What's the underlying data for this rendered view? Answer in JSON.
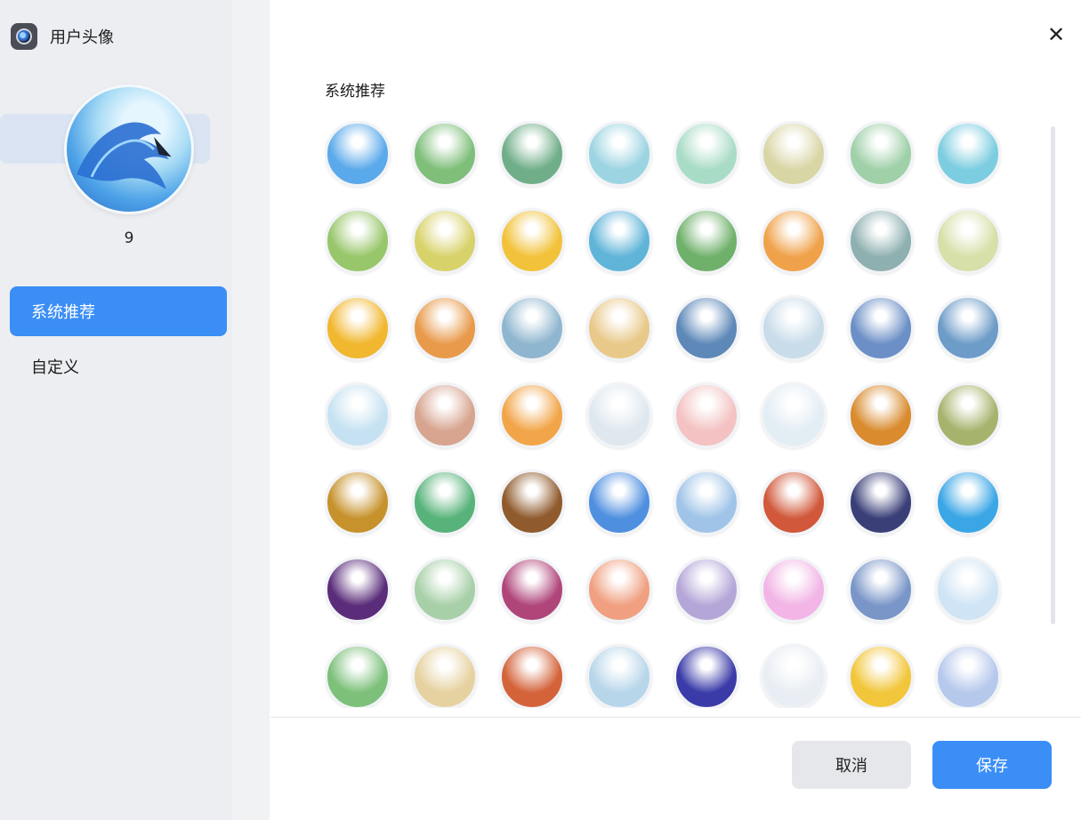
{
  "window": {
    "title": "用户头像"
  },
  "sidebar": {
    "current_avatar_number": "9",
    "items": [
      {
        "label": "系统推荐",
        "active": true
      },
      {
        "label": "自定义",
        "active": false
      }
    ]
  },
  "main": {
    "section_title": "系统推荐",
    "avatars": [
      "#5aa9ea",
      "#7fbf7a",
      "#6fae88",
      "#9cd4e2",
      "#a9dcc6",
      "#d9d6a6",
      "#9fd0a8",
      "#7ccde0",
      "#98c66a",
      "#d8d26a",
      "#f2c23a",
      "#5fb4d8",
      "#6fb06a",
      "#f0a24a",
      "#8fb0b0",
      "#d6e0a8",
      "#f1b72e",
      "#e89a4a",
      "#8fb6cf",
      "#e9c98a",
      "#5d88b8",
      "#c9dcea",
      "#6b8fc6",
      "#6d9cc8",
      "#c6e2f2",
      "#d7a48f",
      "#f2a548",
      "#dfe8ef",
      "#f4c2c2",
      "#e3edf4",
      "#d98b2e",
      "#a6b36c",
      "#c7922c",
      "#58b37a",
      "#8f5a2c",
      "#4f8fe0",
      "#9fc4e8",
      "#d1583a",
      "#3a3f78",
      "#3aa6e6",
      "#5a2c7a",
      "#a8d0a8",
      "#b0457a",
      "#f0a080",
      "#b5a6d8",
      "#f2b5e6",
      "#7a96c8",
      "#cfe4f5",
      "#7cc07a",
      "#e6d2a0",
      "#d4633a",
      "#b8d6ea",
      "#3a3aa8",
      "#e9eef4",
      "#f2c63a",
      "#b6c8ec"
    ],
    "close_icon": "close-icon"
  },
  "footer": {
    "cancel_label": "取消",
    "save_label": "保存"
  },
  "colors": {
    "accent": "#3a8ef6",
    "sidebar_bg": "#eceef2"
  }
}
